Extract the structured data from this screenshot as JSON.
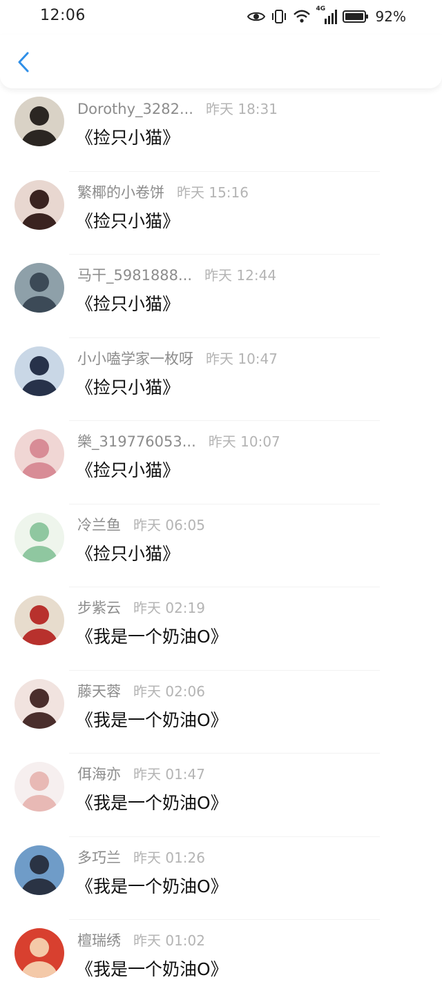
{
  "status_bar": {
    "time": "12:06",
    "network": "4G",
    "battery": "92%"
  },
  "colors": {
    "accent": "#2f8fe8",
    "username": "#8c8c8c",
    "timestamp": "#b4b4b4"
  },
  "items": [
    {
      "username": "Dorothy_3282...",
      "time": "昨天 18:31",
      "content": "《捡只小猫》",
      "avatar_bg": "#d9d2c6",
      "avatar_fg": "#2b2622"
    },
    {
      "username": "繁椰的小卷饼",
      "time": "昨天 15:16",
      "content": "《捡只小猫》",
      "avatar_bg": "#e8d7d0",
      "avatar_fg": "#3a2320"
    },
    {
      "username": "马干_5981888...",
      "time": "昨天 12:44",
      "content": "《捡只小猫》",
      "avatar_bg": "#8ea0a9",
      "avatar_fg": "#3c4a57"
    },
    {
      "username": "小小嗑学家一枚呀",
      "time": "昨天 10:47",
      "content": "《捡只小猫》",
      "avatar_bg": "#c9d7e6",
      "avatar_fg": "#27324a"
    },
    {
      "username": "樂_319776053...",
      "time": "昨天 10:07",
      "content": "《捡只小猫》",
      "avatar_bg": "#f0d6d4",
      "avatar_fg": "#d88c96"
    },
    {
      "username": "冷兰鱼",
      "time": "昨天 06:05",
      "content": "《捡只小猫》",
      "avatar_bg": "#eef5ec",
      "avatar_fg": "#8fc7a0"
    },
    {
      "username": "步紫云",
      "time": "昨天 02:19",
      "content": "《我是一个奶油O》",
      "avatar_bg": "#e7dccd",
      "avatar_fg": "#b8312d"
    },
    {
      "username": "藤天蓉",
      "time": "昨天 02:06",
      "content": "《我是一个奶油O》",
      "avatar_bg": "#f1e3df",
      "avatar_fg": "#4a2e2c"
    },
    {
      "username": "佴海亦",
      "time": "昨天 01:47",
      "content": "《我是一个奶油O》",
      "avatar_bg": "#f6efef",
      "avatar_fg": "#e8b9b5"
    },
    {
      "username": "多巧兰",
      "time": "昨天 01:26",
      "content": "《我是一个奶油O》",
      "avatar_bg": "#6f9cc8",
      "avatar_fg": "#2a3344"
    },
    {
      "username": "檀瑞绣",
      "time": "昨天 01:02",
      "content": "《我是一个奶油O》",
      "avatar_bg": "#d8402f",
      "avatar_fg": "#f4c9a8"
    }
  ]
}
